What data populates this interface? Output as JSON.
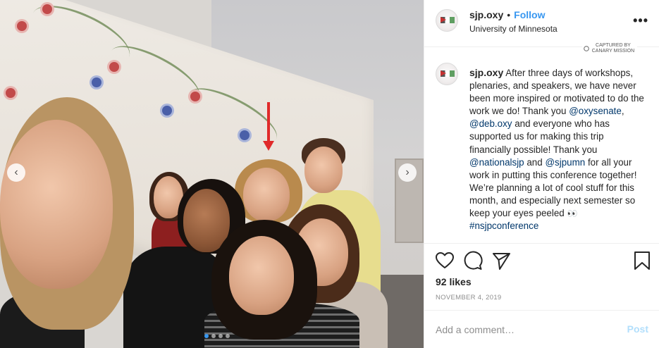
{
  "post": {
    "username": "sjp.oxy",
    "separator": "•",
    "follow_label": "Follow",
    "location": "University of Minnesota",
    "more_label": "•••",
    "watermark": "CAPTURED BY CANARY MISSION"
  },
  "caption": {
    "username": "sjp.oxy",
    "text_1": "After three days of workshops, plenaries, and speakers, we have never been more inspired or motivated to do the work we do! Thank you",
    "mention_1": "@oxysenate",
    "text_2": ",",
    "mention_2": "@deb.oxy",
    "text_3": "and everyone who has supported us for making this trip financially possible! Thank you",
    "mention_3": "@nationalsjp",
    "text_4": "and",
    "mention_4": "@sjpumn",
    "text_5": "for all your work in putting this conference together! We’re planning a lot of cool stuff for this month, and especially next semester so keep your eyes peeled",
    "emoji": "👀",
    "hashtag": "#nsjpconference"
  },
  "stats": {
    "likes": "92 likes",
    "date": "NOVEMBER 4, 2019"
  },
  "comment_box": {
    "placeholder": "Add a comment…",
    "post_label": "Post"
  },
  "carousel": {
    "prev_icon": "‹",
    "next_icon": "›",
    "slide_count": 4,
    "active_slide": 1
  },
  "icons": {
    "like": "heart-icon",
    "comment": "comment-icon",
    "share": "paper-plane-icon",
    "save": "bookmark-icon"
  },
  "colors": {
    "link": "#00376b",
    "follow": "#3897f0",
    "post_disabled": "#b2dffc",
    "arrow": "#e02a2a"
  }
}
